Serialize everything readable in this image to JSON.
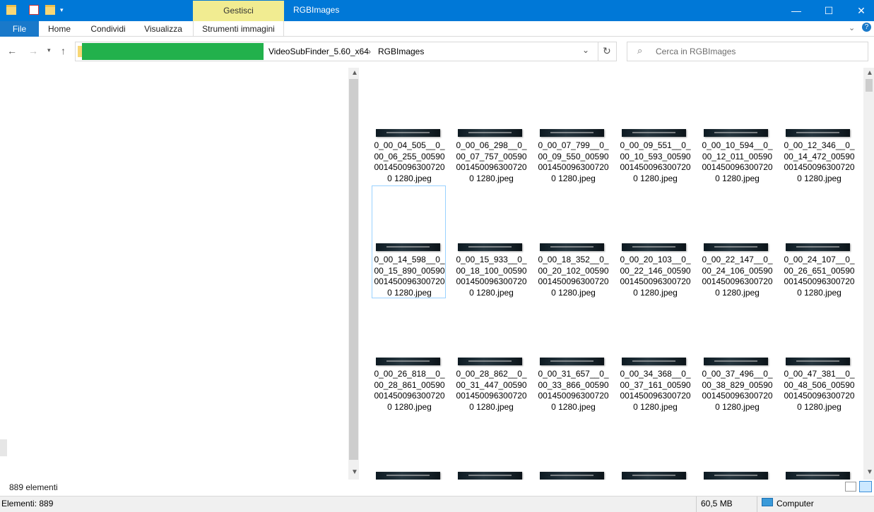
{
  "window": {
    "title": "RGBImages",
    "context_tab": "Gestisci",
    "accent": "#0078d7"
  },
  "ribbon": {
    "tabs": [
      {
        "label": "File"
      },
      {
        "label": "Home"
      },
      {
        "label": "Condividi"
      },
      {
        "label": "Visualizza"
      },
      {
        "label": "Strumenti immagini"
      }
    ]
  },
  "address": {
    "crumbs": [
      "VideoSubFinder_5.60_x64",
      "RGBImages"
    ],
    "search_placeholder": "Cerca in RGBImages"
  },
  "files": [
    {
      "name": "0_00_04_505__0_00_06_255_005900014500963007200 1280.jpeg"
    },
    {
      "name": "0_00_06_298__0_00_07_757_005900014500963007200 1280.jpeg"
    },
    {
      "name": "0_00_07_799__0_00_09_550_005900014500963007200 1280.jpeg"
    },
    {
      "name": "0_00_09_551__0_00_10_593_005900014500963007200 1280.jpeg"
    },
    {
      "name": "0_00_10_594__0_00_12_011_005900014500963007200 1280.jpeg"
    },
    {
      "name": "0_00_12_346__0_00_14_472_005900014500963007200 1280.jpeg"
    },
    {
      "name": "0_00_14_598__0_00_15_890_005900014500963007200 1280.jpeg"
    },
    {
      "name": "0_00_15_933__0_00_18_100_005900014500963007200 1280.jpeg"
    },
    {
      "name": "0_00_18_352__0_00_20_102_005900014500963007200 1280.jpeg"
    },
    {
      "name": "0_00_20_103__0_00_22_146_005900014500963007200 1280.jpeg"
    },
    {
      "name": "0_00_22_147__0_00_24_106_005900014500963007200 1280.jpeg"
    },
    {
      "name": "0_00_24_107__0_00_26_651_005900014500963007200 1280.jpeg"
    },
    {
      "name": "0_00_26_818__0_00_28_861_005900014500963007200 1280.jpeg"
    },
    {
      "name": "0_00_28_862__0_00_31_447_005900014500963007200 1280.jpeg"
    },
    {
      "name": "0_00_31_657__0_00_33_866_005900014500963007200 1280.jpeg"
    },
    {
      "name": "0_00_34_368__0_00_37_161_005900014500963007200 1280.jpeg"
    },
    {
      "name": "0_00_37_496__0_00_38_829_005900014500963007200 1280.jpeg"
    },
    {
      "name": "0_00_47_381__0_00_48_506_005900014500963007200 1280.jpeg"
    }
  ],
  "status": {
    "item_count": "889 elementi",
    "elements": "Elementi: 889",
    "size": "60,5 MB",
    "location": "Computer"
  }
}
